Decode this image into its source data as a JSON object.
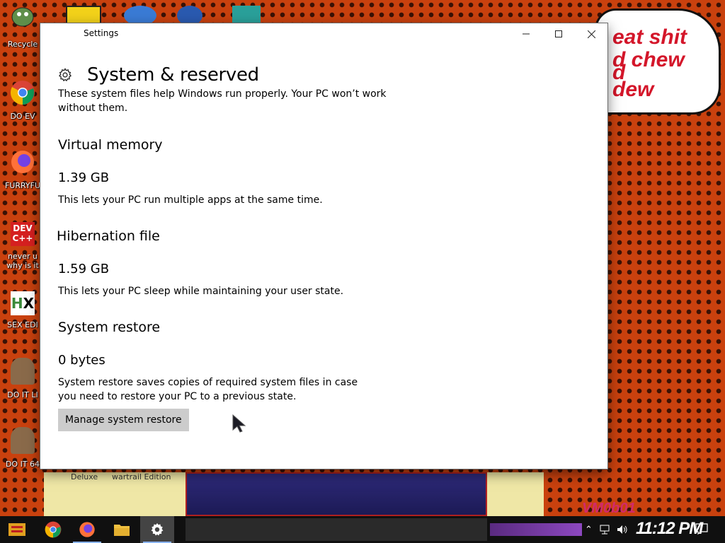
{
  "desktop": {
    "icons": [
      {
        "label": "Recycle",
        "name": "recycle-bin"
      },
      {
        "label": "DO EV",
        "name": "chrome-shortcut"
      },
      {
        "label": "FURRYFU",
        "name": "firefox-shortcut"
      },
      {
        "label": "never u",
        "label2": "why is it",
        "name": "devcpp-shortcut"
      },
      {
        "label": "SEX EDI",
        "name": "hex-editor-shortcut"
      },
      {
        "label": "DO IT LI",
        "name": "portrait-shortcut-1"
      },
      {
        "label": "DO IT 64",
        "name": "portrait-shortcut-2"
      }
    ],
    "speech_lines": [
      "eat shit",
      "d chew",
      "d",
      "dew"
    ],
    "caption_left": "Deluxe",
    "caption_mid": "wartrail Edition",
    "watermark": "VM0b01"
  },
  "window": {
    "title": "Settings",
    "page_title": "System & reserved",
    "intro": "These system files help Windows run properly. Your PC won’t work without them.",
    "sections": [
      {
        "title": "Virtual memory",
        "size": "1.39 GB",
        "desc": "This lets your PC run multiple apps at the same time."
      },
      {
        "title": "Hibernation file",
        "size": "1.59 GB",
        "desc": "This lets your PC sleep while maintaining your user state."
      },
      {
        "title": "System restore",
        "size": "0 bytes",
        "desc": "System restore saves copies of required system files in case you need to restore your PC to a previous state."
      }
    ],
    "restore_button": "Manage system restore"
  },
  "taskbar": {
    "clock": "11:12 PM",
    "apps": [
      "start-button",
      "chrome",
      "firefox",
      "file-explorer",
      "settings"
    ]
  },
  "colors": {
    "desktop_bg": "#c9410e",
    "taskbar": "#101010",
    "button_gray": "#cccccc"
  }
}
